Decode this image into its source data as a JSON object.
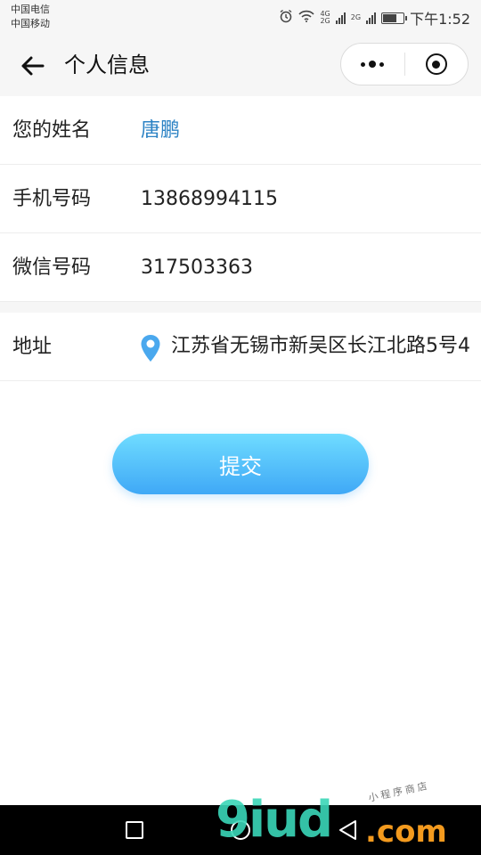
{
  "status_bar": {
    "carrier_1": "中国电信",
    "carrier_2": "中国移动",
    "net_a_top": "4G",
    "net_a_bottom": "2G",
    "net_b": "2G",
    "time": "下午1:52",
    "battery_level": 0.7
  },
  "nav": {
    "title": "个人信息"
  },
  "form": {
    "rows": [
      {
        "label": "您的姓名",
        "value": "唐鹏"
      },
      {
        "label": "手机号码",
        "value": "13868994115"
      },
      {
        "label": "微信号码",
        "value": "317503363"
      },
      {
        "label": "地址",
        "value": "江苏省无锡市新吴区长江北路5号4"
      }
    ]
  },
  "submit": {
    "label": "提交"
  },
  "watermark": {
    "logo": "9iud",
    "suffix": ".com",
    "small": "小程序商店"
  },
  "colors": {
    "accent_blue": "#2b82c4",
    "button_gradient_top": "#6fdcff",
    "button_gradient_bottom": "#3fa8f6",
    "location_icon": "#4aa8ee"
  }
}
